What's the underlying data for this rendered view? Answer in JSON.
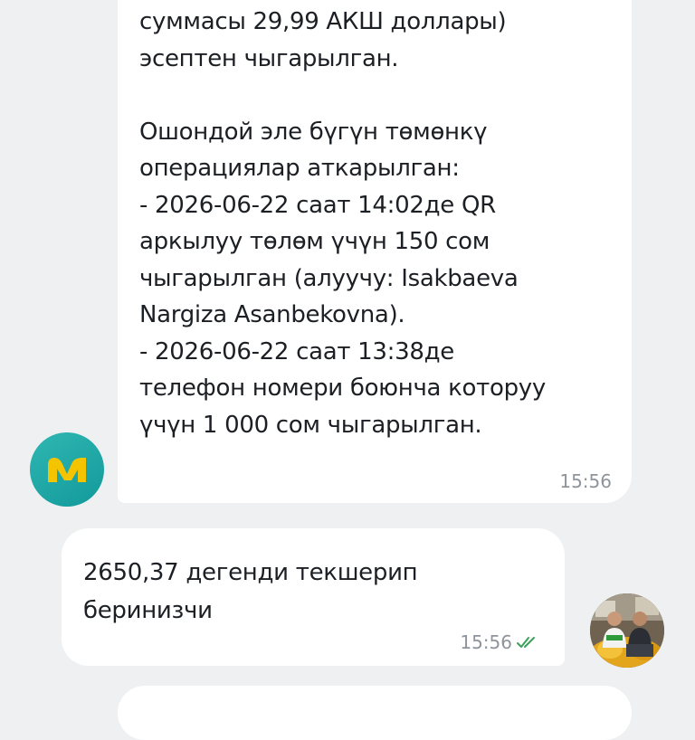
{
  "messages": {
    "incoming": {
      "text": "суммасы 29,99 АКШ доллары)\nэсептен чыгарылган.\n\nОшондой эле бүгүн төмөнкү\nоперациялар аткарылган:\n- 2026-06-22 саат 14:02де QR\nаркылуу төлөм үчүн 150 сом\nчыгарылган (алуучу: Isakbaeva\nNargiza Asanbekovna).\n- 2026-06-22 саат 13:38де\nтелефон номери боюнча которуу\nүчүн 1 000 сом чыгарылган.",
      "time": "15:56",
      "sender_avatar_icon": "bank-logo-icon"
    },
    "outgoing": {
      "text": "2650,37 дегенди текшерип\nберинизчи",
      "time": "15:56",
      "status_icon": "double-check-icon"
    }
  },
  "colors": {
    "background": "#eef0f2",
    "bubble": "#ffffff",
    "bank_avatar": "#1aa6a6",
    "bank_logo": "#f5c400",
    "read_check": "#3aa15a"
  }
}
